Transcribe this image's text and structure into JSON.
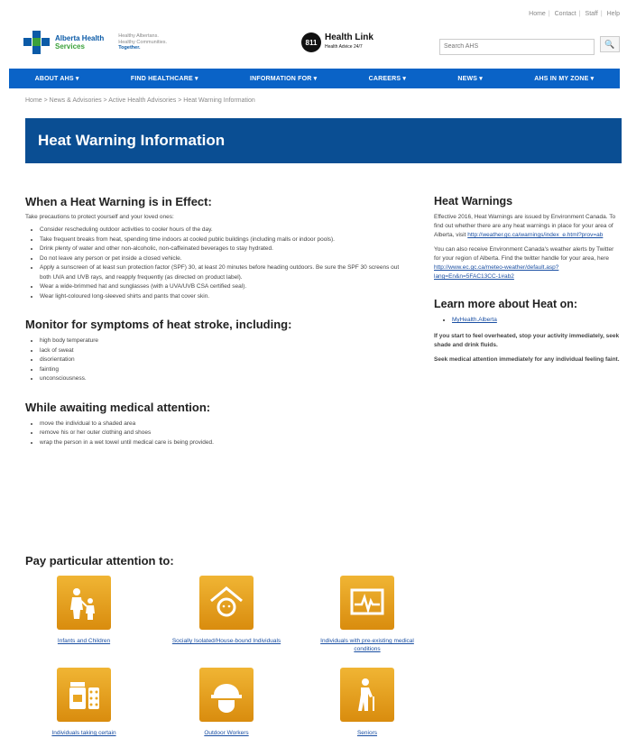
{
  "utility": {
    "home": "Home",
    "contact": "Contact",
    "staff": "Staff",
    "help": "Help"
  },
  "logo": {
    "line1": "Alberta Health",
    "line2": "Services",
    "tagline1": "Healthy Albertans.",
    "tagline2": "Healthy Communities.",
    "tagline3": "Together."
  },
  "healthlink": {
    "badge": "811",
    "name": "Health Link",
    "sub": "Health Advice 24/7"
  },
  "search": {
    "placeholder": "Search AHS",
    "button": "🔍"
  },
  "nav": [
    "ABOUT AHS ▾",
    "FIND HEALTHCARE ▾",
    "INFORMATION FOR ▾",
    "CAREERS ▾",
    "NEWS ▾",
    "AHS IN MY ZONE ▾"
  ],
  "breadcrumb": "Home > News & Advisories > Active Health Advisories > Heat Warning Information",
  "page_title": "Heat Warning Information",
  "effect": {
    "heading": "When a Heat Warning is in Effect:",
    "intro": "Take precautions to protect yourself and your loved ones:",
    "items": [
      "Consider rescheduling outdoor activities to cooler hours of the day.",
      "Take frequent breaks from heat, spending time indoors at cooled public buildings (including malls or indoor pools).",
      "Drink plenty of water and other non-alcoholic, non-caffeinated beverages to stay hydrated.",
      "Do not leave any person or pet inside a closed vehicle.",
      "Apply a sunscreen of at least sun protection factor (SPF) 30, at least 20 minutes before heading outdoors. Be sure the SPF 30 screens out both UVA and UVB rays, and reapply frequently (as directed on product label).",
      "Wear a wide-brimmed hat and sunglasses (with a UVA/UVB CSA certified seal).",
      "Wear light-coloured long-sleeved shirts and pants that cover skin."
    ]
  },
  "monitor": {
    "heading": "Monitor for symptoms of heat stroke, including:",
    "items": [
      "high body temperature",
      "lack of sweat",
      "disorientation",
      "fainting",
      "unconsciousness."
    ]
  },
  "awaiting": {
    "heading": "While awaiting medical attention:",
    "items": [
      "move the individual to a shaded area",
      "remove his or her outer clothing and shoes",
      "wrap the person in a wet towel until medical care is being provided."
    ]
  },
  "attention": {
    "heading": "Pay particular attention to:",
    "tiles": [
      {
        "label": "Infants and Children",
        "icon": "family-icon"
      },
      {
        "label": "Socially Isolated/House-bound Individuals",
        "icon": "house-person-icon"
      },
      {
        "label": "Individuals with pre-existing medical conditions",
        "icon": "heart-monitor-icon"
      },
      {
        "label": "Individuals taking certain",
        "icon": "medication-icon"
      },
      {
        "label": "Outdoor Workers",
        "icon": "hard-hat-icon"
      },
      {
        "label": "Seniors",
        "icon": "senior-cane-icon"
      }
    ]
  },
  "sidebar": {
    "warnings_heading": "Heat Warnings",
    "warnings_p1_text": "Effective 2016, Heat Warnings are issued by Environment Canada. To find out whether there are any heat warnings in place for your area of Alberta, visit",
    "warnings_p1_link": "http://weather.gc.ca/warnings/index_e.html?prov=ab",
    "warnings_p2_text": "You can also receive Environment Canada's weather alerts by Twitter for your region of Alberta. Find the twitter handle for your area, here",
    "warnings_p2_link": "http://www.ec.gc.ca/meteo-weather/default.asp?lang=En&n=5FAC13CC-1#ab2",
    "learn_heading": "Learn more about Heat on:",
    "learn_link": "MyHealth.Alberta",
    "advice1": "If you start to feel overheated, stop your activity immediately, seek shade and drink fluids.",
    "advice2": "Seek medical attention immediately for any individual feeling faint."
  },
  "colors": {
    "nav": "#0a63c7",
    "banner": "#0a4e93",
    "tile": "#e9a521"
  }
}
